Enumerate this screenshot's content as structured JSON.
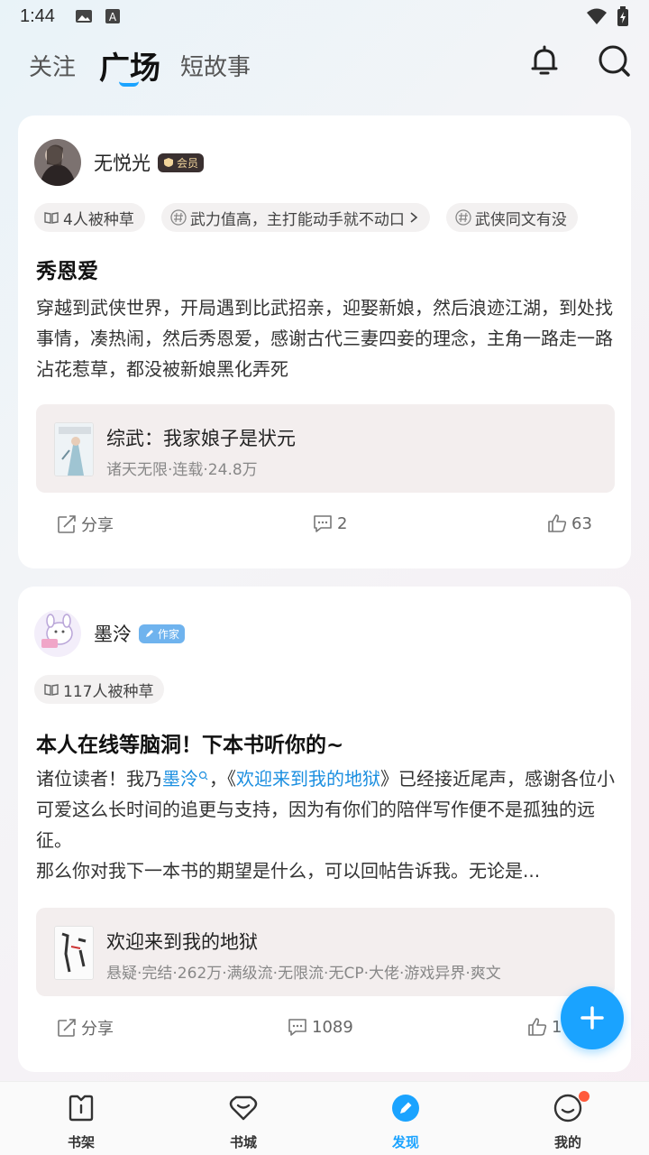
{
  "status_bar": {
    "time": "1:44"
  },
  "tabs": [
    {
      "label": "关注"
    },
    {
      "label": "广场"
    },
    {
      "label": "短故事"
    }
  ],
  "posts": [
    {
      "author": "无悦光",
      "badge": "会员",
      "tags": [
        "4人被种草",
        "武力值高，主打能动手就不动口",
        "武侠同文有没"
      ],
      "title": "秀恩爱",
      "body": "穿越到武侠世界，开局遇到比武招亲，迎娶新娘，然后浪迹江湖，到处找事情，凑热闹，然后秀恩爱，感谢古代三妻四妾的理念，主角一路走一路沾花惹草，都没被新娘黑化弄死",
      "book_title": "综武：我家娘子是状元",
      "book_meta": "诸天无限·连载·24.8万",
      "share": "分享",
      "comments": "2",
      "likes": "63"
    },
    {
      "author": "墨泠",
      "badge": "作家",
      "tags": [
        "117人被种草"
      ],
      "title": "本人在线等脑洞！下本书听你的~",
      "body_pre": "诸位读者！我乃",
      "body_link1": "墨泠",
      "body_mid": "，《",
      "body_link2": "欢迎来到我的地狱",
      "body_post": "》已经接近尾声，感谢各位小可爱这么长时间的追更与支持，因为有你们的陪伴写作便不是孤独的远征。",
      "body_line4": "那么你对我下一本书的期望是什么，可以回帖告诉我。无论是...",
      "book_title": "欢迎来到我的地狱",
      "book_meta": "悬疑·完结·262万·满级流·无限流·无CP·大佬·游戏异界·爽文",
      "share": "分享",
      "comments": "1089",
      "likes": "1"
    }
  ],
  "bottom_nav": [
    {
      "label": "书架"
    },
    {
      "label": "书城"
    },
    {
      "label": "发现"
    },
    {
      "label": "我的"
    }
  ],
  "colors": {
    "accent": "#1aa3ff",
    "link": "#1c8fe0",
    "notify_dot": "#ff5a3c"
  }
}
